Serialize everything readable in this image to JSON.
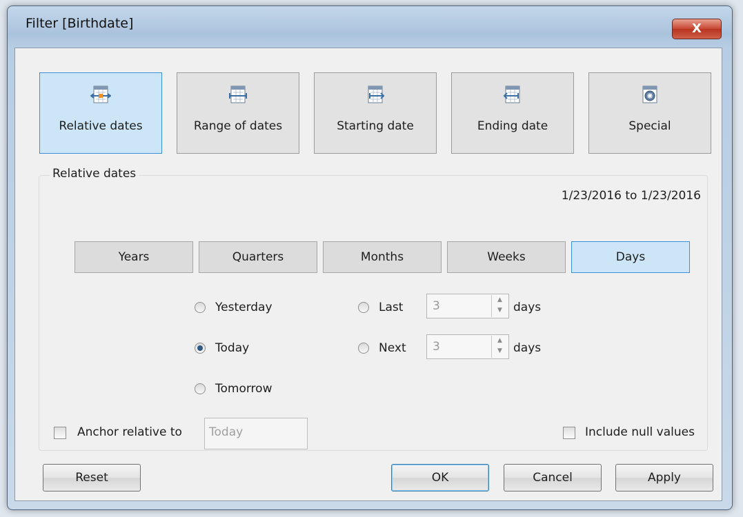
{
  "window": {
    "title": "Filter [Birthdate]",
    "close_label": "X"
  },
  "modes": [
    {
      "label": "Relative dates",
      "icon": "relative-dates-icon",
      "active": true
    },
    {
      "label": "Range of dates",
      "icon": "range-of-dates-icon",
      "active": false
    },
    {
      "label": "Starting date",
      "icon": "starting-date-icon",
      "active": false
    },
    {
      "label": "Ending date",
      "icon": "ending-date-icon",
      "active": false
    },
    {
      "label": "Special",
      "icon": "special-icon",
      "active": false
    }
  ],
  "relative": {
    "group_title": "Relative dates",
    "range_text": "1/23/2016 to 1/23/2016",
    "units": [
      "Years",
      "Quarters",
      "Months",
      "Weeks",
      "Days"
    ],
    "selected_unit": "Days",
    "options": {
      "yesterday": "Yesterday",
      "today": "Today",
      "tomorrow": "Tomorrow",
      "last": "Last",
      "next": "Next",
      "last_value": "3",
      "next_value": "3",
      "unit_word": "days",
      "selected": "Today"
    },
    "anchor_label": "Anchor relative to",
    "anchor_value": "Today",
    "include_null_label": "Include null values"
  },
  "buttons": {
    "reset": "Reset",
    "ok": "OK",
    "cancel": "Cancel",
    "apply": "Apply"
  },
  "colors": {
    "accent": "#3a8fd6",
    "active_fill": "#cde6f7",
    "close_red": "#c94a35"
  }
}
